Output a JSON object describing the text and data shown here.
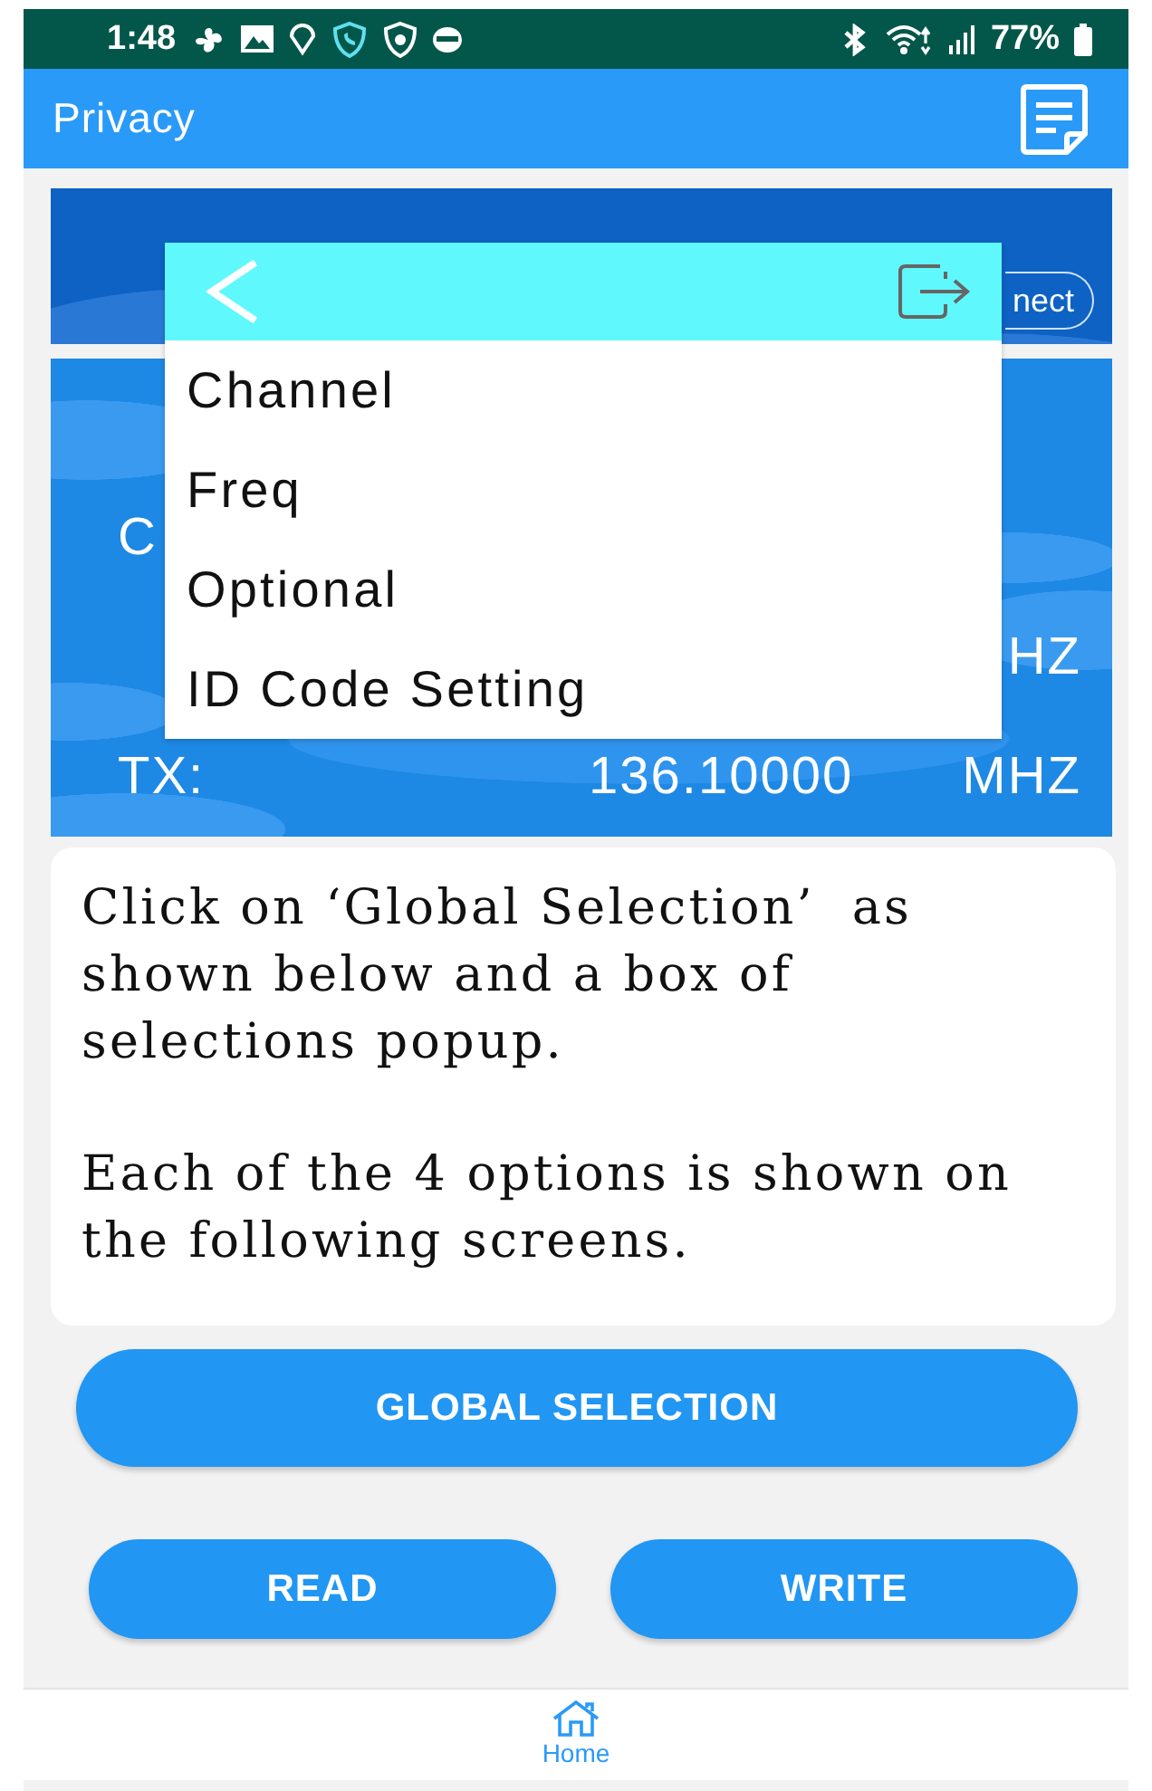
{
  "status_bar": {
    "time": "1:48",
    "battery": "77%"
  },
  "app_bar": {
    "title": "Privacy"
  },
  "device": {
    "connect_button": "nect"
  },
  "channel_panel": {
    "rows": [
      {
        "label": "C"
      },
      {
        "unit": "HZ"
      },
      {
        "label": "TX:",
        "value": "136.10000",
        "unit": "MHZ"
      }
    ]
  },
  "popup": {
    "items": [
      "Channel",
      "Freq",
      "Optional",
      "ID Code Setting"
    ]
  },
  "info_card": {
    "paragraphs": [
      "Click on ‘Global Selection’  as shown below and a box of selections popup.",
      "Each of the 4 options is shown on the following screens."
    ]
  },
  "actions": [
    {
      "label": "GLOBAL SELECTION",
      "kind": "wide"
    },
    {
      "label": "READ",
      "kind": "half"
    },
    {
      "label": "WRITE",
      "kind": "half"
    }
  ],
  "bottom_nav": {
    "items": [
      {
        "label": "Home",
        "selected": true
      }
    ]
  }
}
